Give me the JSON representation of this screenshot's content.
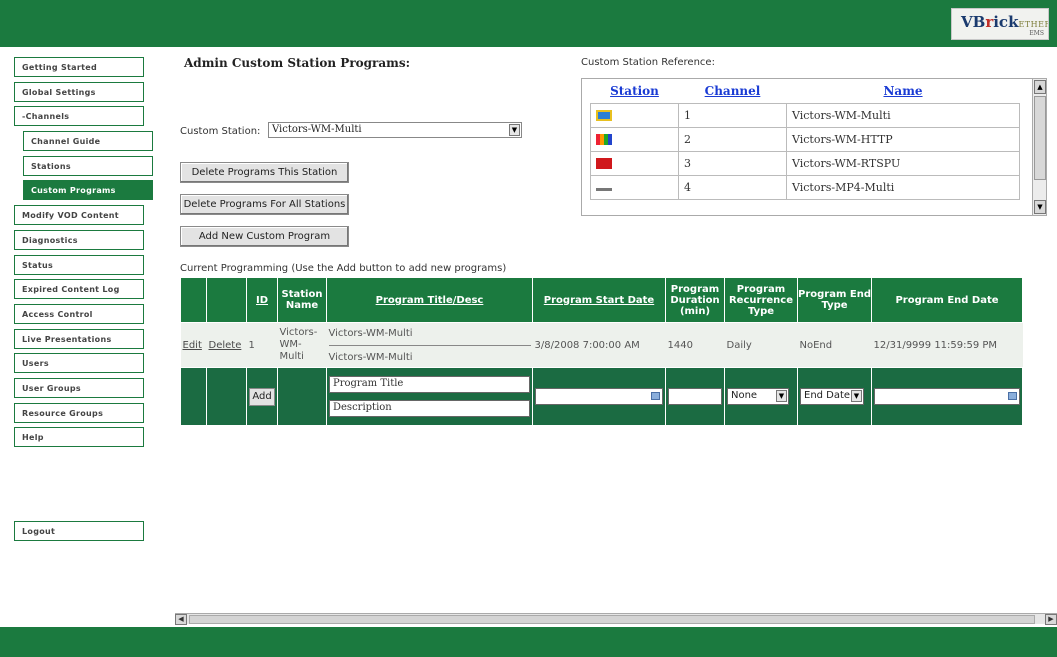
{
  "logo": {
    "brand_vb": "VB",
    "brand_r": "r",
    "brand_ick": "ick",
    "tagline": "ETHERNETV",
    "sub": "EMS"
  },
  "nav": {
    "items": [
      {
        "label": "Getting Started"
      },
      {
        "label": "Global Settings"
      },
      {
        "label": "-Channels"
      },
      {
        "label": "Channel Guide"
      },
      {
        "label": "Stations"
      },
      {
        "label": "Custom Programs"
      },
      {
        "label": "Modify VOD Content"
      },
      {
        "label": "Diagnostics"
      },
      {
        "label": "Status"
      },
      {
        "label": "Expired Content Log"
      },
      {
        "label": "Access Control"
      },
      {
        "label": "Live Presentations"
      },
      {
        "label": "Users"
      },
      {
        "label": "User Groups"
      },
      {
        "label": "Resource Groups"
      },
      {
        "label": "Help"
      }
    ],
    "logout": "Logout"
  },
  "main": {
    "title": "Admin Custom Station Programs:",
    "station_label": "Custom Station:",
    "station_selected": "Victors-WM-Multi",
    "buttons": {
      "delete_station": "Delete Programs This Station",
      "delete_all": "Delete Programs For All Stations",
      "add_new": "Add New Custom Program"
    },
    "current_label": "Current Programming (Use the Add button to add new programs)"
  },
  "reference": {
    "title": "Custom Station Reference:",
    "headers": [
      "Station",
      "Channel",
      "Name"
    ],
    "rows": [
      {
        "channel": "1",
        "name": "Victors-WM-Multi",
        "icon": "tv-logo-icon"
      },
      {
        "channel": "2",
        "name": "Victors-WM-HTTP",
        "icon": "nbc-logo-icon"
      },
      {
        "channel": "3",
        "name": "Victors-WM-RTSPU",
        "icon": "red-logo-icon"
      },
      {
        "channel": "4",
        "name": "Victors-MP4-Multi",
        "icon": "dash-logo-icon"
      }
    ]
  },
  "programs": {
    "headers": {
      "id": "ID",
      "station_name": "Station Name",
      "title_desc": "Program Title/Desc",
      "start_date": "Program Start Date",
      "duration": "Program Duration (min)",
      "recurrence": "Program Recurrence Type",
      "end_type": "Program End Type",
      "end_date": "Program End Date"
    },
    "row": {
      "edit": "Edit",
      "delete": "Delete",
      "id": "1",
      "station_name": "Victors-WM-Multi",
      "title": "Victors-WM-Multi",
      "desc": "Victors-WM-Multi",
      "start_date": "3/8/2008 7:00:00 AM",
      "duration": "1440",
      "recurrence": "Daily",
      "end_type": "NoEnd",
      "end_date": "12/31/9999 11:59:59 PM"
    },
    "new_row": {
      "add": "Add",
      "title_value": "Program Title",
      "desc_value": "Description",
      "recurrence": "None",
      "end_type": "End Date"
    }
  },
  "colors": {
    "brand_green": "#1b7a3f"
  }
}
